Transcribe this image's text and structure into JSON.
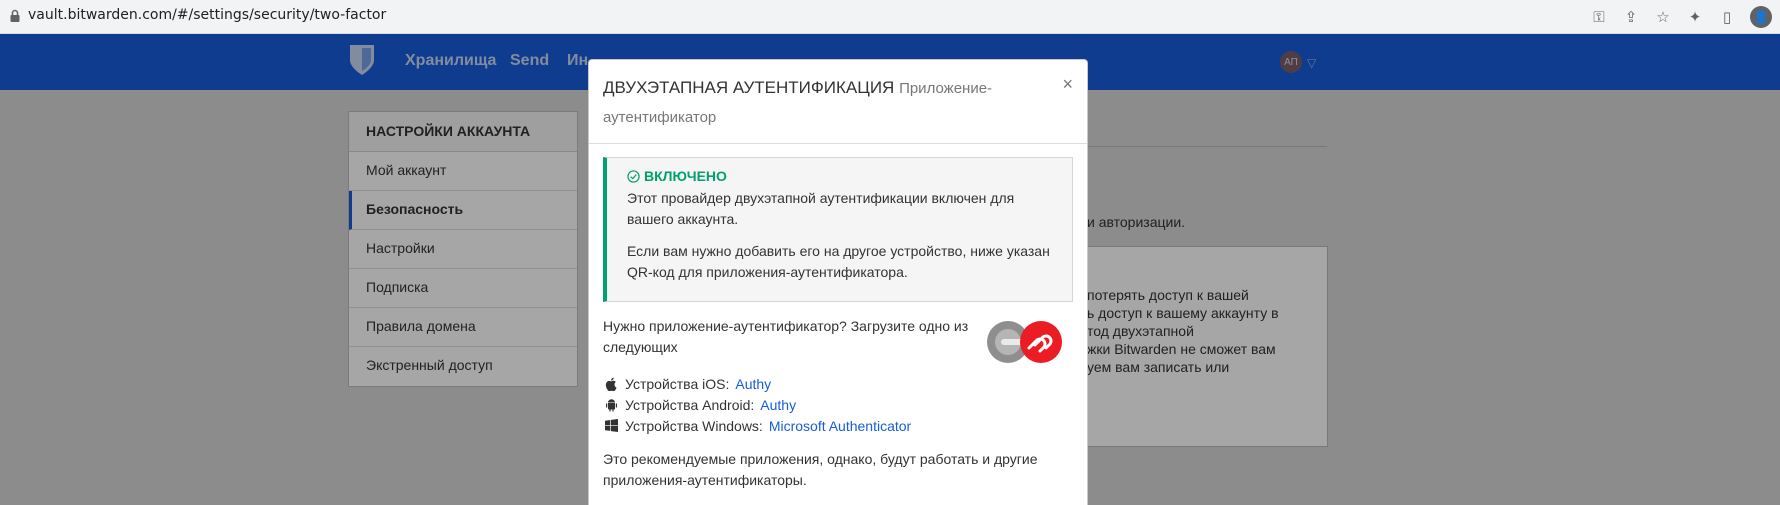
{
  "browser": {
    "url": "vault.bitwarden.com/#/settings/security/two-factor",
    "profile_initial": "👤"
  },
  "navbar": {
    "links": [
      "Хранилища",
      "Send",
      "Ин"
    ],
    "avatar_initials": "АП"
  },
  "sidebar": {
    "header": "НАСТРОЙКИ АККАУНТА",
    "items": [
      {
        "label": "Мой аккаунт",
        "active": false
      },
      {
        "label": "Безопасность",
        "active": true
      },
      {
        "label": "Настройки",
        "active": false
      },
      {
        "label": "Подписка",
        "active": false
      },
      {
        "label": "Правила домена",
        "active": false
      },
      {
        "label": "Экстренный доступ",
        "active": false
      }
    ]
  },
  "background_content": {
    "text_line": "и авторизации.",
    "warning_lines": [
      "потерять доступ к вашей",
      "ь доступ к вашему аккаунту в",
      "тод двухэтапной",
      "жки Bitwarden не сможет вам",
      "уем вам записать или"
    ]
  },
  "modal": {
    "title": "ДВУХЭТАПНАЯ АУТЕНТИФИКАЦИЯ",
    "subtitle": "Приложение-аутентификатор",
    "close_label": "×",
    "enabled": {
      "title": "ВКЛЮЧЕНО",
      "text1": "Этот провайдер двухэтапной аутентификации включен для вашего аккаунта.",
      "text2": "Если вам нужно добавить его на другое устройство, ниже указан QR-код для приложения-аутентификатора."
    },
    "need_app_text": "Нужно приложение-аутентификатор? Загрузите одно из следующих",
    "devices": [
      {
        "label": "Устройства iOS:",
        "link": "Authy",
        "icon": "apple-icon"
      },
      {
        "label": "Устройства Android:",
        "link": "Authy",
        "icon": "android-icon"
      },
      {
        "label": "Устройства Windows:",
        "link": "Microsoft Authenticator",
        "icon": "windows-icon"
      }
    ],
    "recommend_text": "Это рекомендуемые приложения, однако, будут работать и другие приложения-аутентификаторы."
  },
  "colors": {
    "brand": "#175ddc",
    "success": "#01a071",
    "authy_red": "#ec1c24"
  }
}
